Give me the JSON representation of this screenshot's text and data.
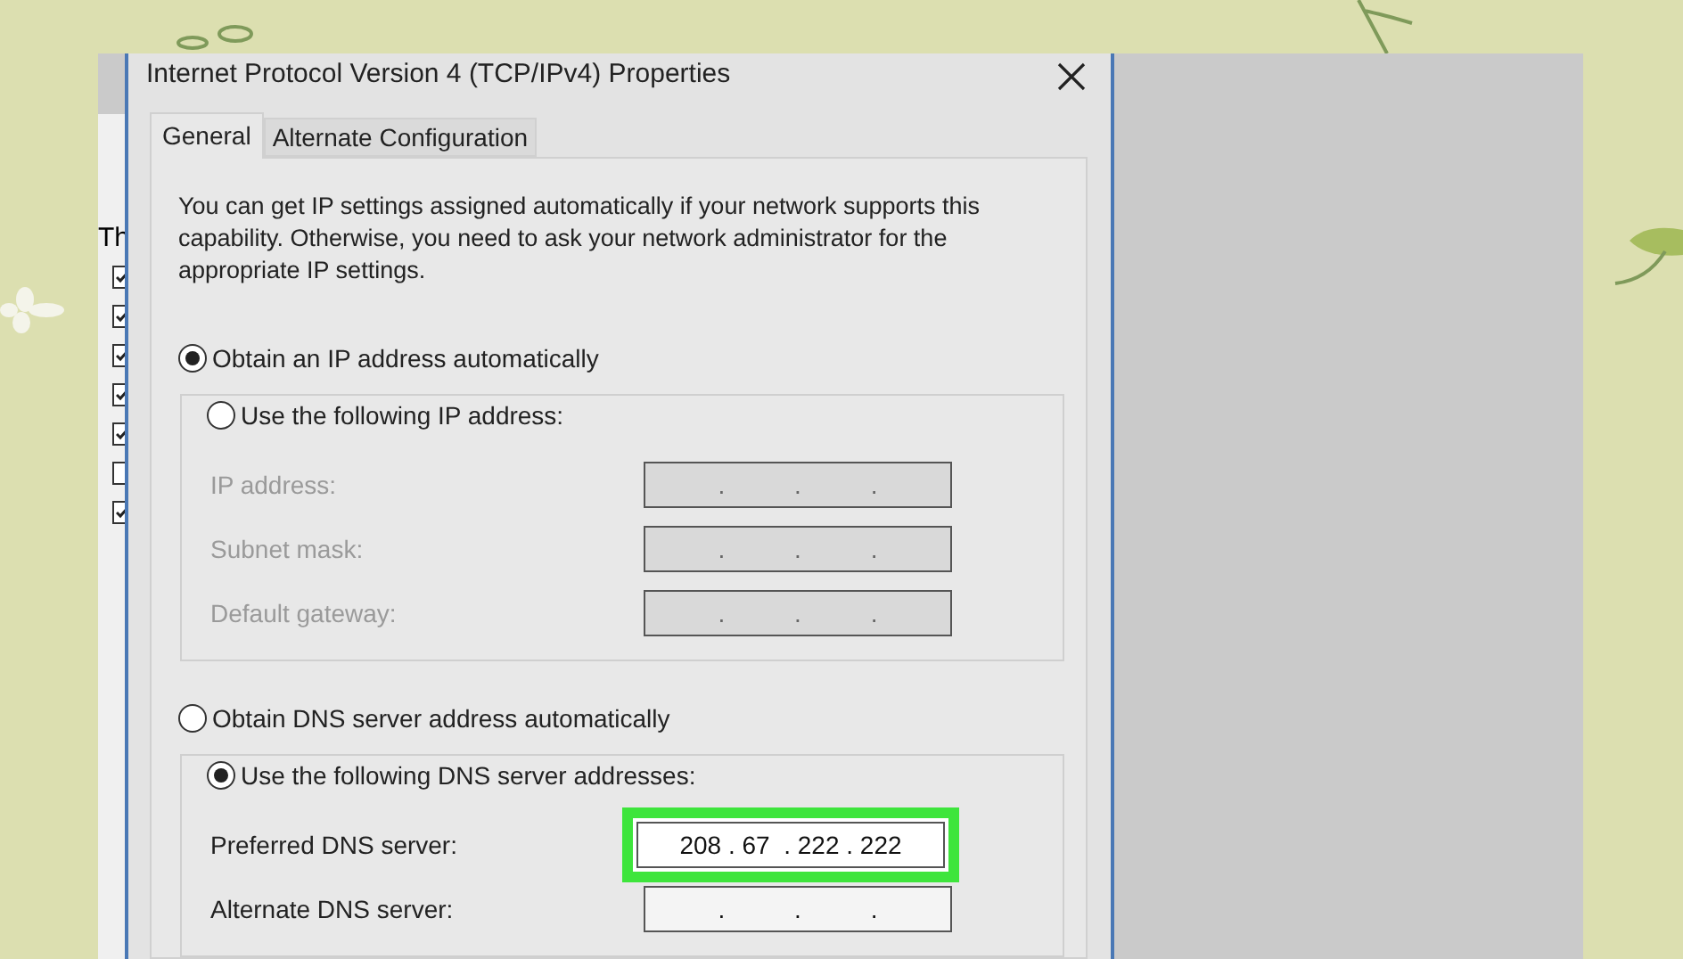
{
  "background_window": {
    "text": "Th",
    "checkboxes": [
      {
        "checked": true
      },
      {
        "checked": true
      },
      {
        "checked": true
      },
      {
        "checked": true
      },
      {
        "checked": true
      },
      {
        "checked": false
      },
      {
        "checked": true
      }
    ]
  },
  "window": {
    "title": "Internet Protocol Version 4 (TCP/IPv4) Properties"
  },
  "tabs": [
    {
      "label": "General",
      "selected": true
    },
    {
      "label": "Alternate Configuration",
      "selected": false
    }
  ],
  "description": "You can get IP settings assigned automatically if your network supports this capability. Otherwise, you need to ask your network administrator for the appropriate IP settings.",
  "ip_section": {
    "options": [
      {
        "label": "Obtain an IP address automatically",
        "selected": true
      },
      {
        "label": "Use the following IP address:",
        "selected": false
      }
    ],
    "fields": [
      {
        "label": "IP address:",
        "value": ".          .          .",
        "disabled": true,
        "highlighted": false
      },
      {
        "label": "Subnet mask:",
        "value": ".          .          .",
        "disabled": true,
        "highlighted": false
      },
      {
        "label": "Default gateway:",
        "value": ".          .          .",
        "disabled": true,
        "highlighted": false
      }
    ]
  },
  "dns_section": {
    "options": [
      {
        "label": "Obtain DNS server address automatically",
        "selected": false
      },
      {
        "label": "Use the following DNS server addresses:",
        "selected": true
      }
    ],
    "fields": [
      {
        "label": "Preferred DNS server:",
        "value": "208 . 67  . 222 . 222",
        "disabled": false,
        "highlighted": true
      },
      {
        "label": "Alternate DNS server:",
        "value": ".          .          .",
        "disabled": false,
        "highlighted": false
      }
    ]
  }
}
